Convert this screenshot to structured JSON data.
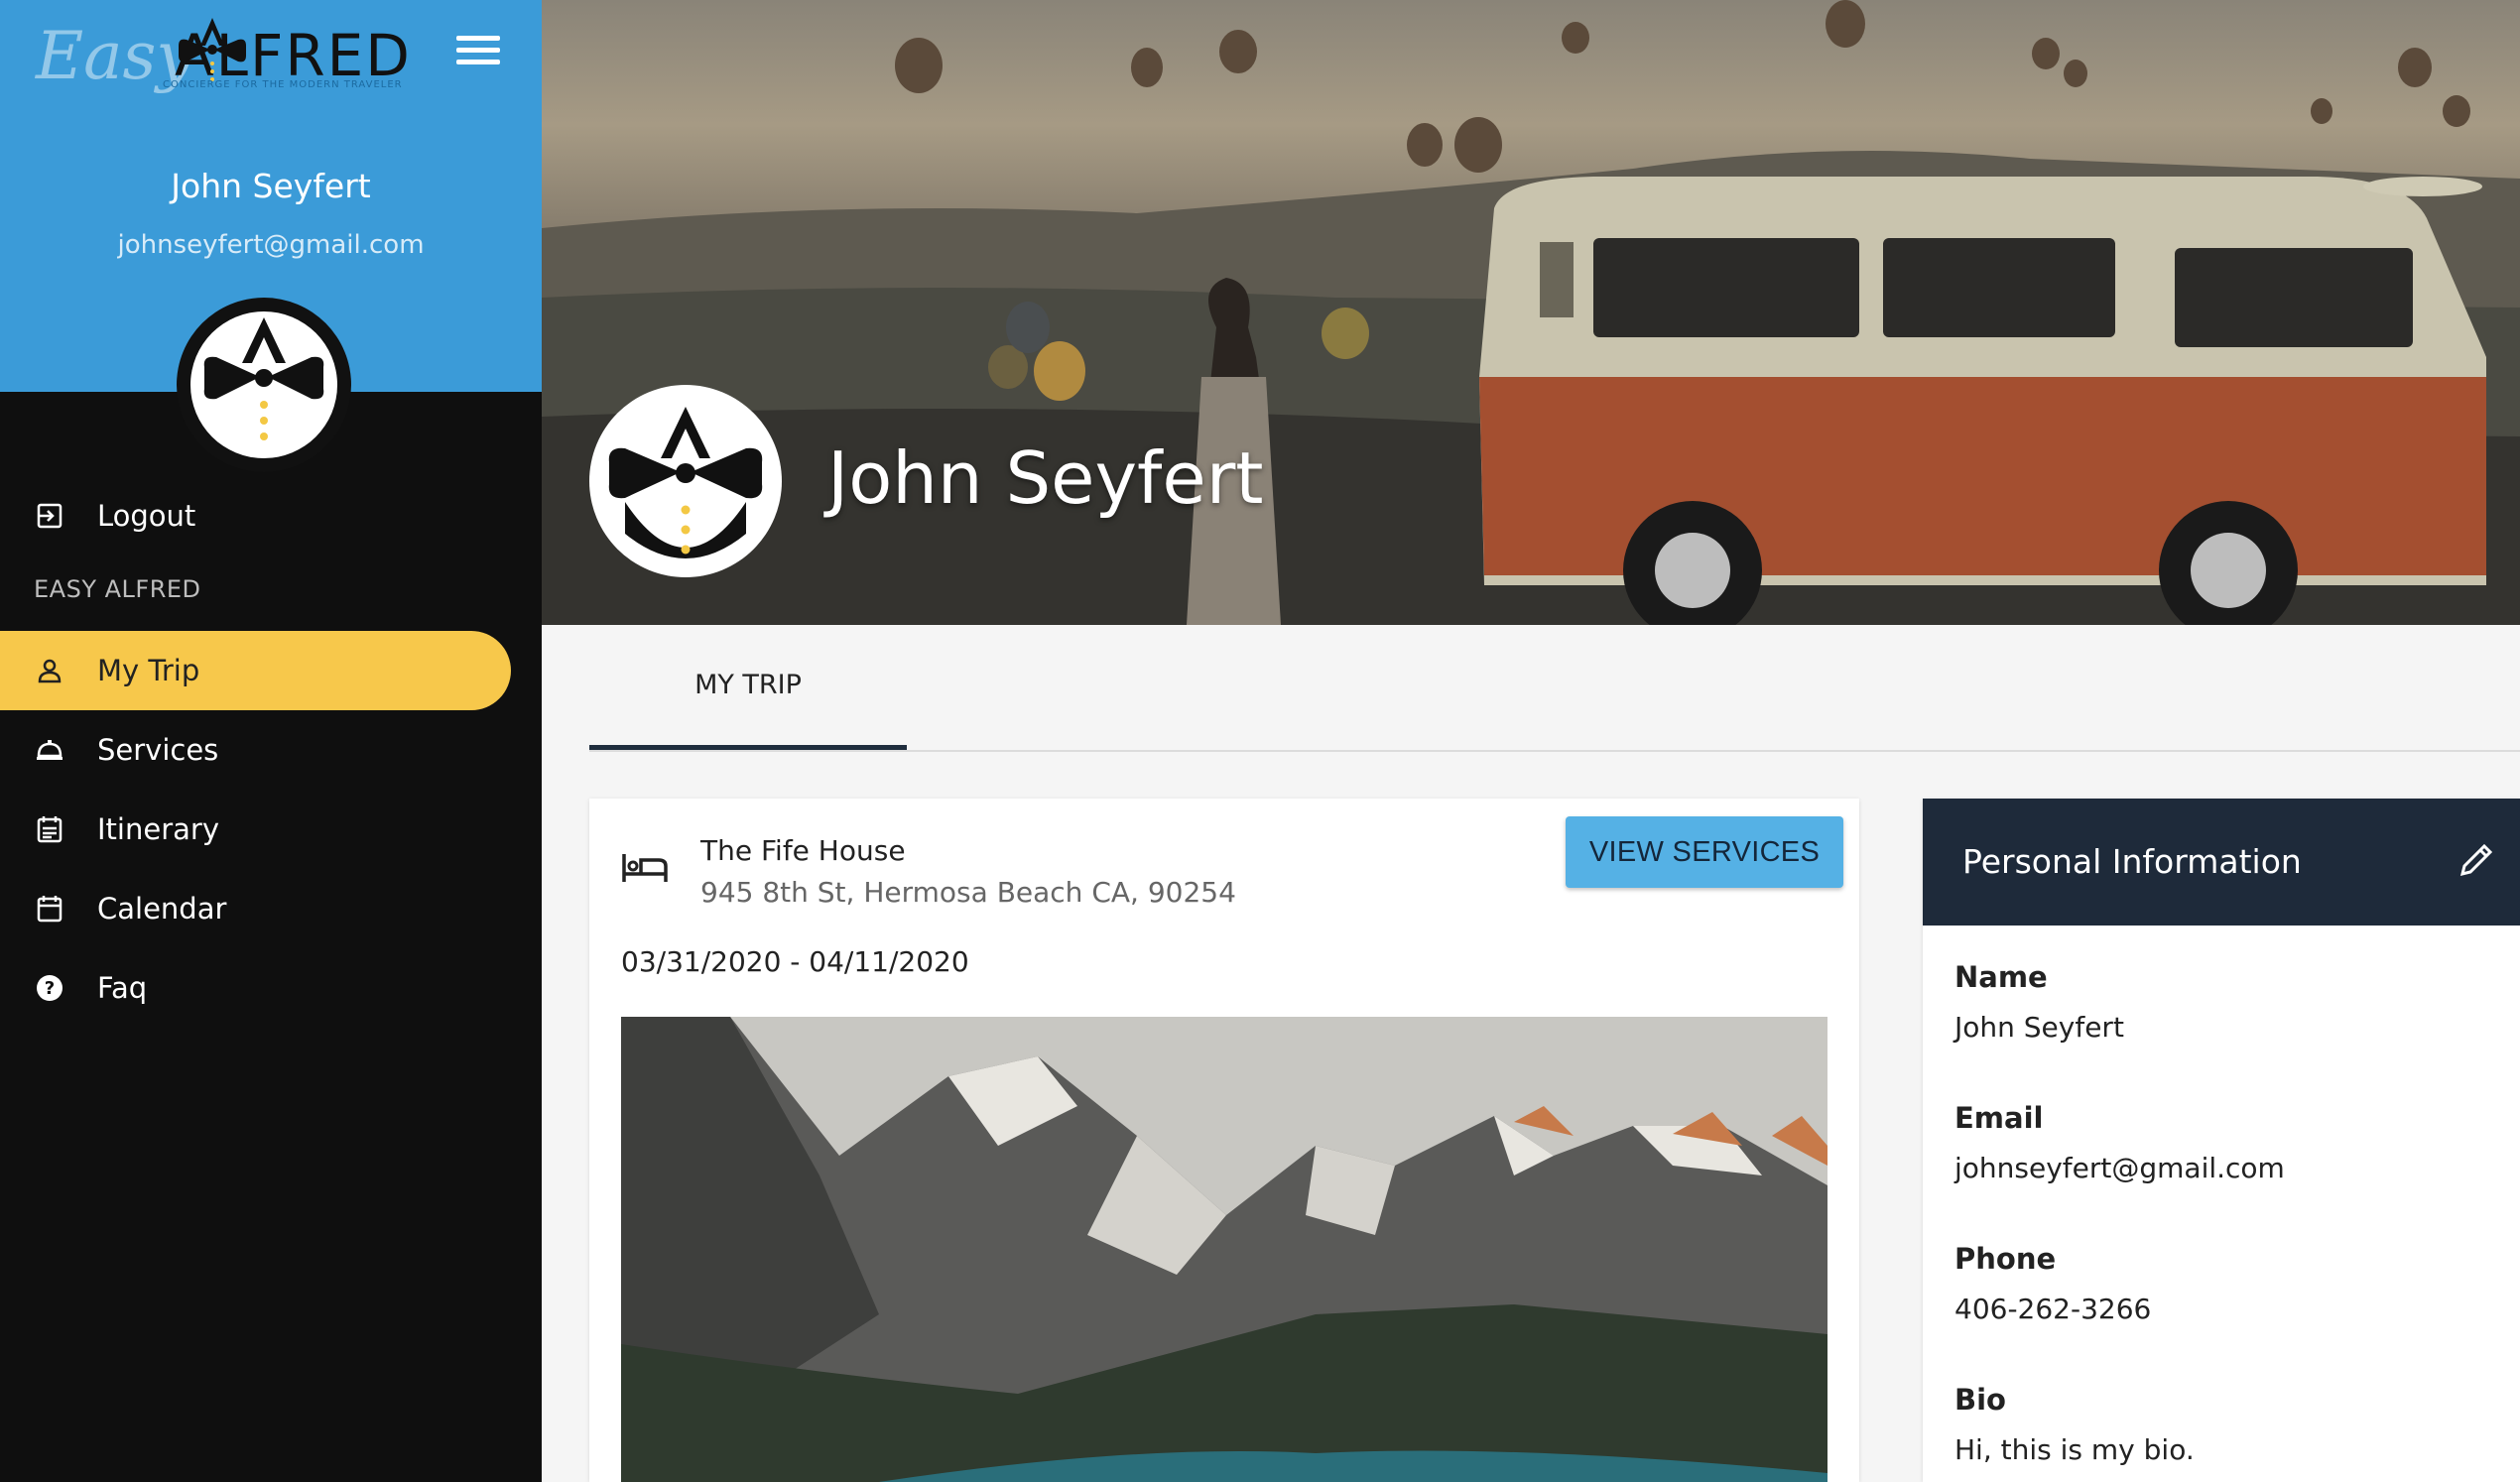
{
  "brand": {
    "logo_script": "Easy",
    "logo_word": "ALFRED",
    "tagline": "CONCIERGE FOR THE MODERN TRAVELER"
  },
  "sidebar": {
    "user_name": "John Seyfert",
    "user_email": "johnseyfert@gmail.com",
    "logout_label": "Logout",
    "section_title": "EASY ALFRED",
    "items": [
      {
        "label": "My Trip",
        "icon": "person-icon",
        "active": true
      },
      {
        "label": "Services",
        "icon": "cloche-icon",
        "active": false
      },
      {
        "label": "Itinerary",
        "icon": "itinerary-icon",
        "active": false
      },
      {
        "label": "Calendar",
        "icon": "calendar-icon",
        "active": false
      },
      {
        "label": "Faq",
        "icon": "help-icon",
        "active": false
      }
    ]
  },
  "hero": {
    "name": "John Seyfert"
  },
  "tabs": [
    {
      "label": "MY TRIP",
      "active": true
    }
  ],
  "trip": {
    "hotel_name": "The Fife House",
    "hotel_address": "945 8th St, Hermosa Beach CA, 90254",
    "view_services_label": "VIEW SERVICES",
    "dates": "03/31/2020 - 04/11/2020"
  },
  "personal_info": {
    "title": "Personal Information",
    "fields": [
      {
        "label": "Name",
        "value": "John Seyfert"
      },
      {
        "label": "Email",
        "value": "johnseyfert@gmail.com"
      },
      {
        "label": "Phone",
        "value": "406-262-3266"
      },
      {
        "label": "Bio",
        "value": "Hi, this is my bio."
      }
    ]
  },
  "colors": {
    "sidebar_top": "#3b9bd8",
    "sidebar": "#0f0f0f",
    "active_item": "#f7c84b",
    "button": "#55b1e5",
    "info_header": "#1e2a3a",
    "tab_indicator": "#1f2d3d"
  }
}
